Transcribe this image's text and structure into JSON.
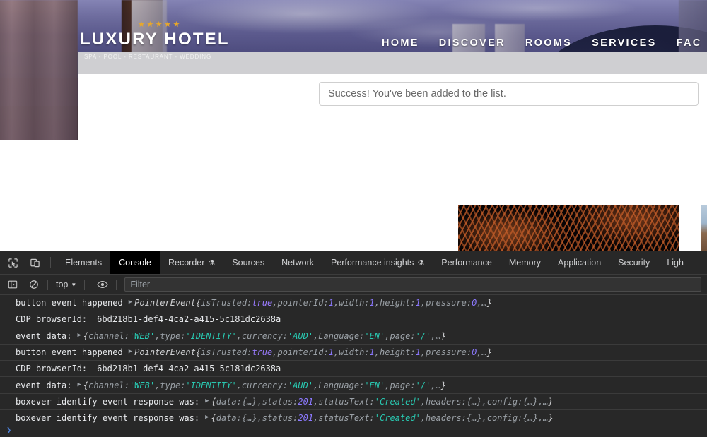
{
  "site": {
    "brand_stars": "★★★★★",
    "brand_name": "LUXURY HOTEL",
    "brand_tagline": "SPA - POOL - RESTAURANT - WEDDING",
    "nav": [
      {
        "label": "HOME"
      },
      {
        "label": "DISCOVER"
      },
      {
        "label": "ROOMS"
      },
      {
        "label": "SERVICES"
      },
      {
        "label": "FAC"
      }
    ],
    "alert": {
      "message": "Success! You've been added to the list."
    }
  },
  "devtools": {
    "toolbar_icons": [
      {
        "name": "inspect-element-icon"
      },
      {
        "name": "device-toolbar-icon"
      }
    ],
    "tabs": [
      {
        "label": "Elements",
        "active": false,
        "flask": false
      },
      {
        "label": "Console",
        "active": true,
        "flask": false
      },
      {
        "label": "Recorder",
        "active": false,
        "flask": true
      },
      {
        "label": "Sources",
        "active": false,
        "flask": false
      },
      {
        "label": "Network",
        "active": false,
        "flask": false
      },
      {
        "label": "Performance insights",
        "active": false,
        "flask": true
      },
      {
        "label": "Performance",
        "active": false,
        "flask": false
      },
      {
        "label": "Memory",
        "active": false,
        "flask": false
      },
      {
        "label": "Application",
        "active": false,
        "flask": false
      },
      {
        "label": "Security",
        "active": false,
        "flask": false
      },
      {
        "label": "Ligh",
        "active": false,
        "flask": false
      }
    ],
    "flask_glyph": "⚗",
    "filterbar": {
      "sidebar_toggle_name": "console-sidebar-icon",
      "clear_console_name": "clear-console-icon",
      "context_label": "top",
      "context_caret": "▼",
      "eye_icon_name": "live-expression-icon",
      "filter_placeholder": "Filter",
      "filter_value": ""
    },
    "prompt_caret": "❯",
    "console_rows": [
      {
        "label": "button event happened",
        "kind": "object",
        "triangle": "▶",
        "constructor": "PointerEvent",
        "open": "{",
        "props": [
          {
            "key": "isTrusted",
            "value": "true",
            "type": "bool"
          },
          {
            "key": "pointerId",
            "value": "1",
            "type": "num"
          },
          {
            "key": "width",
            "value": "1",
            "type": "num"
          },
          {
            "key": "height",
            "value": "1",
            "type": "num"
          },
          {
            "key": "pressure",
            "value": "0",
            "type": "num"
          }
        ],
        "ellipsis": "…",
        "close": "}"
      },
      {
        "label": "CDP browserId:",
        "kind": "text",
        "text": "6bd218b1-def4-4ca2-a415-5c181dc2638a"
      },
      {
        "label": "event data:",
        "kind": "object",
        "triangle": "▶",
        "constructor": "",
        "open": "{",
        "props": [
          {
            "key": "channel",
            "value": "'WEB'",
            "type": "str"
          },
          {
            "key": "type",
            "value": "'IDENTITY'",
            "type": "str"
          },
          {
            "key": "currency",
            "value": "'AUD'",
            "type": "str"
          },
          {
            "key": "Language",
            "value": "'EN'",
            "type": "str"
          },
          {
            "key": "page",
            "value": "'/'",
            "type": "str"
          }
        ],
        "ellipsis": "…",
        "close": "}"
      },
      {
        "label": "button event happened",
        "kind": "object",
        "triangle": "▶",
        "constructor": "PointerEvent",
        "open": "{",
        "props": [
          {
            "key": "isTrusted",
            "value": "true",
            "type": "bool"
          },
          {
            "key": "pointerId",
            "value": "1",
            "type": "num"
          },
          {
            "key": "width",
            "value": "1",
            "type": "num"
          },
          {
            "key": "height",
            "value": "1",
            "type": "num"
          },
          {
            "key": "pressure",
            "value": "0",
            "type": "num"
          }
        ],
        "ellipsis": "…",
        "close": "}"
      },
      {
        "label": "CDP browserId:",
        "kind": "text",
        "text": "6bd218b1-def4-4ca2-a415-5c181dc2638a"
      },
      {
        "label": "event data:",
        "kind": "object",
        "triangle": "▶",
        "constructor": "",
        "open": "{",
        "props": [
          {
            "key": "channel",
            "value": "'WEB'",
            "type": "str"
          },
          {
            "key": "type",
            "value": "'IDENTITY'",
            "type": "str"
          },
          {
            "key": "currency",
            "value": "'AUD'",
            "type": "str"
          },
          {
            "key": "Language",
            "value": "'EN'",
            "type": "str"
          },
          {
            "key": "page",
            "value": "'/'",
            "type": "str"
          }
        ],
        "ellipsis": "…",
        "close": "}"
      },
      {
        "label": "boxever identify event response was:",
        "kind": "object",
        "triangle": "▶",
        "constructor": "",
        "open": "{",
        "props": [
          {
            "key": "data",
            "value": "{…}",
            "type": "dim"
          },
          {
            "key": "status",
            "value": "201",
            "type": "num"
          },
          {
            "key": "statusText",
            "value": "'Created'",
            "type": "str"
          },
          {
            "key": "headers",
            "value": "{…}",
            "type": "dim"
          },
          {
            "key": "config",
            "value": "{…}",
            "type": "dim"
          }
        ],
        "ellipsis": "…",
        "close": "}"
      },
      {
        "label": "boxever identify event response was:",
        "kind": "object",
        "triangle": "▶",
        "constructor": "",
        "open": "{",
        "props": [
          {
            "key": "data",
            "value": "{…}",
            "type": "dim"
          },
          {
            "key": "status",
            "value": "201",
            "type": "num"
          },
          {
            "key": "statusText",
            "value": "'Created'",
            "type": "str"
          },
          {
            "key": "headers",
            "value": "{…}",
            "type": "dim"
          },
          {
            "key": "config",
            "value": "{…}",
            "type": "dim"
          }
        ],
        "ellipsis": "…",
        "close": "}"
      }
    ]
  },
  "colors": {
    "devtools_bg": "#282828",
    "devtools_border": "#3b3b3b",
    "tab_active_bg": "#000000",
    "string_green": "#29c7b0",
    "number_purple": "#8c79ff",
    "star_gold": "#e8a829",
    "alert_text": "#6a6a6a",
    "graybar": "#cfcfd2"
  }
}
